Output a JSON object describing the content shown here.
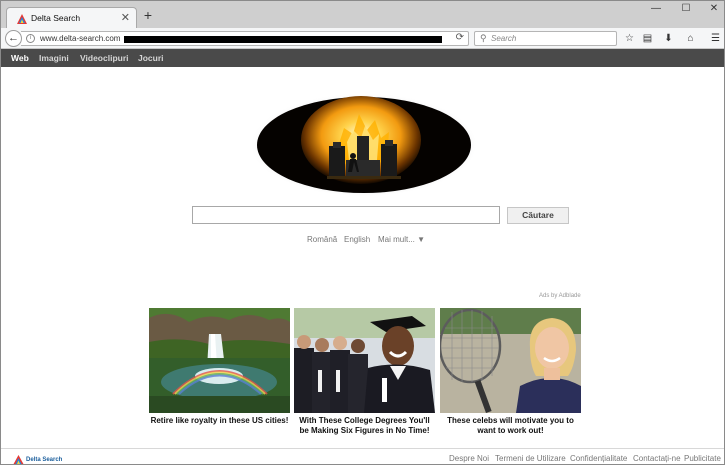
{
  "browser": {
    "tab_title": "Delta Search",
    "tab_close": "✕",
    "new_tab": "+",
    "url_text": "www.delta-search.com",
    "search_placeholder": "Search",
    "window_controls": [
      "—",
      "☐",
      "✕"
    ]
  },
  "nav": {
    "items": [
      "Web",
      "Imagini",
      "Videoclipuri",
      "Jocuri"
    ],
    "active": "Web"
  },
  "search": {
    "button_label": "Căutare",
    "query": ""
  },
  "languages": [
    "Română",
    "English",
    "Mai mult... ▼"
  ],
  "ads": {
    "label": "Ads by Adblade",
    "items": [
      {
        "caption": "Retire like royalty in these US cities!"
      },
      {
        "caption": "With These College Degrees You'll be Making Six Figures in No Time!"
      },
      {
        "caption": "These celebs will motivate you to want to work out!"
      }
    ]
  },
  "footer": {
    "logo_text": "Delta Search",
    "links": [
      "Despre Noi",
      "Termeni de Utilizare",
      "Confidențialitate",
      "Contactați-ne",
      "Publicitate"
    ]
  },
  "colors": {
    "sitenav_bg": "#4a4a4a",
    "logo_orange": "#f5a623",
    "delta_blue": "#1b5e9c"
  }
}
